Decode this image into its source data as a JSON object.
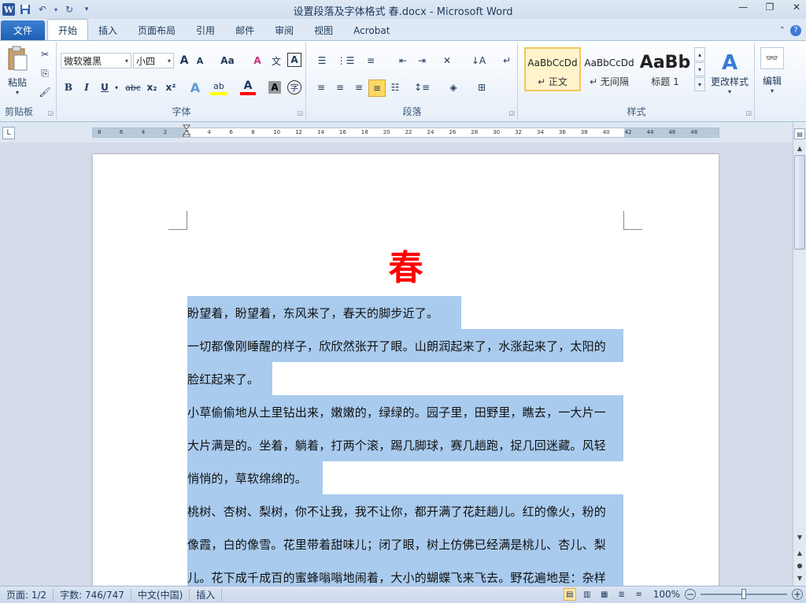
{
  "window": {
    "title": "设置段落及字体格式 春.docx - Microsoft Word",
    "controls": [
      "—",
      "❐",
      "✕"
    ]
  },
  "qat": {
    "app_icon": "W"
  },
  "tabs": [
    {
      "label": "文件"
    },
    {
      "label": "开始"
    },
    {
      "label": "插入"
    },
    {
      "label": "页面布局"
    },
    {
      "label": "引用"
    },
    {
      "label": "邮件"
    },
    {
      "label": "审阅"
    },
    {
      "label": "视图"
    },
    {
      "label": "Acrobat"
    }
  ],
  "ribbon": {
    "clipboard": {
      "group_label": "剪贴板",
      "paste_label": "粘贴"
    },
    "font": {
      "group_label": "字体",
      "font_name": "微软雅黑",
      "font_size": "小四",
      "grow_icon": "A",
      "shrink_icon": "A",
      "case_label": "Aa",
      "clear_icon": "A",
      "phonetic_icon": "文",
      "border_char_icon": "A",
      "bold": "B",
      "italic": "I",
      "underline": "U",
      "strike": "abc",
      "subscript": "x₂",
      "superscript": "x²",
      "effects_icon": "A",
      "highlight_icon": "ab",
      "font_color_icon": "A",
      "char_shading_icon": "A",
      "enclose_icon": "字"
    },
    "paragraph": {
      "group_label": "段落"
    },
    "styles": {
      "group_label": "样式",
      "items": [
        {
          "sample": "AaBbCcDd",
          "name": "↵ 正文"
        },
        {
          "sample": "AaBbCcDd",
          "name": "↵ 无间隔"
        },
        {
          "sample": "AaBb",
          "name": "标题 1"
        }
      ],
      "change_styles": "更改样式"
    },
    "editing": {
      "label": "编辑"
    }
  },
  "ruler": {
    "ticks": [
      "8",
      "6",
      "4",
      "2",
      "2",
      "4",
      "6",
      "8",
      "10",
      "12",
      "14",
      "16",
      "18",
      "20",
      "22",
      "24",
      "26",
      "28",
      "30",
      "32",
      "34",
      "36",
      "38",
      "40",
      "42",
      "44",
      "46",
      "48"
    ]
  },
  "document": {
    "title": "春",
    "title_color": "#ff0000",
    "selection_color": "#a9cbee",
    "lines": [
      "盼望着，盼望着，东风来了，春天的脚步近了。",
      "一切都像刚睡醒的样子，欣欣然张开了眼。山朗润起来了，水涨起来了，太阳的",
      "脸红起来了。",
      "小草偷偷地从土里钻出来，嫩嫩的，绿绿的。园子里，田野里，瞧去，一大片一",
      "大片满是的。坐着，躺着，打两个滚，踢几脚球，赛几趟跑，捉几回迷藏。风轻",
      "悄悄的，草软绵绵的。",
      "桃树、杏树、梨树，你不让我，我不让你，都开满了花赶趟儿。红的像火，粉的",
      "像霞，白的像雪。花里带着甜味儿；闭了眼，树上仿佛已经满是桃儿、杏儿、梨",
      "儿。花下成千成百的蜜蜂嗡嗡地闹着，大小的蝴蝶飞来飞去。野花遍地是：杂样"
    ]
  },
  "status": {
    "page": "页面: 1/2",
    "words": "字数: 746/747",
    "language": "中文(中国)",
    "mode": "插入",
    "zoom": "100%",
    "zoom_fraction": 0.5
  }
}
